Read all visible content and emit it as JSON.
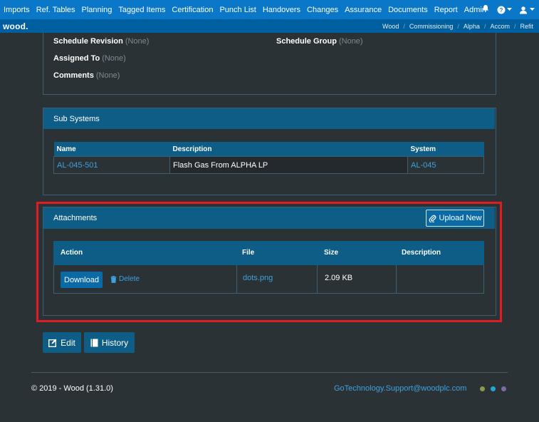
{
  "nav": {
    "items": [
      "Imports",
      "Ref. Tables",
      "Planning",
      "Tagged Items",
      "Certification",
      "Punch List",
      "Handovers",
      "Changes",
      "Assurance",
      "Documents",
      "Report",
      "Admin"
    ],
    "bell_icon": "bell-icon",
    "help_icon": "help-icon",
    "user_icon": "user-icon"
  },
  "subbar": {
    "logo": "wood.",
    "breadcrumbs": [
      "Wood",
      "Commissioning",
      "Alpha",
      "Accom",
      "Refit"
    ]
  },
  "details": {
    "schedule_revision_label": "Schedule Revision",
    "schedule_revision_value": "(None)",
    "schedule_group_label": "Schedule Group",
    "schedule_group_value": "(None)",
    "assigned_to_label": "Assigned To",
    "assigned_to_value": "(None)",
    "comments_label": "Comments",
    "comments_value": "(None)"
  },
  "subsystems": {
    "title": "Sub Systems",
    "columns": [
      "Name",
      "Description",
      "System"
    ],
    "rows": [
      {
        "name": "AL-045-501",
        "description": "Flash Gas From ALPHA LP",
        "system": "AL-045"
      }
    ]
  },
  "attachments": {
    "title": "Attachments",
    "upload_label": "Upload New",
    "columns": [
      "Action",
      "File",
      "Size",
      "Description"
    ],
    "rows": [
      {
        "download_label": "Download",
        "delete_label": "Delete",
        "file": "dots.png",
        "size": "2.09 KB",
        "description": ""
      }
    ]
  },
  "actions": {
    "edit_label": "Edit",
    "history_label": "History"
  },
  "footer": {
    "copyright": "© 2019 - Wood (1.31.0)",
    "email": "GoTechnology.Support@woodplc.com",
    "dot_colors": [
      "#8a9a4a",
      "#23a7d9",
      "#7c6aa0"
    ]
  },
  "colors": {
    "accent": "#0a77c8",
    "panel_header": "#0d5d86",
    "link": "#3fa1e0",
    "highlight": "#e11b22"
  }
}
